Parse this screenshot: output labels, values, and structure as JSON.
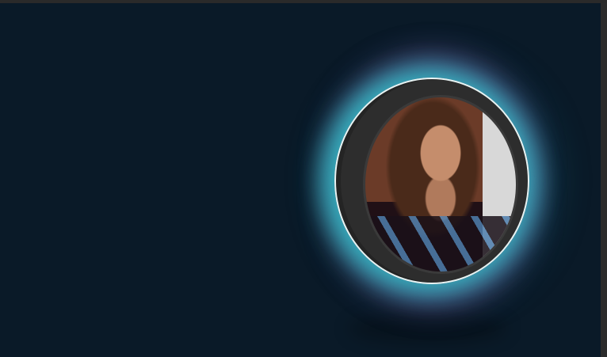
{
  "colors": {
    "background": "#0a1a28",
    "glow_primary": "#28d2d2",
    "glow_secondary": "#c850c8",
    "ring": "#2d2d2d"
  },
  "avatar": {
    "alt": "profile photo"
  }
}
